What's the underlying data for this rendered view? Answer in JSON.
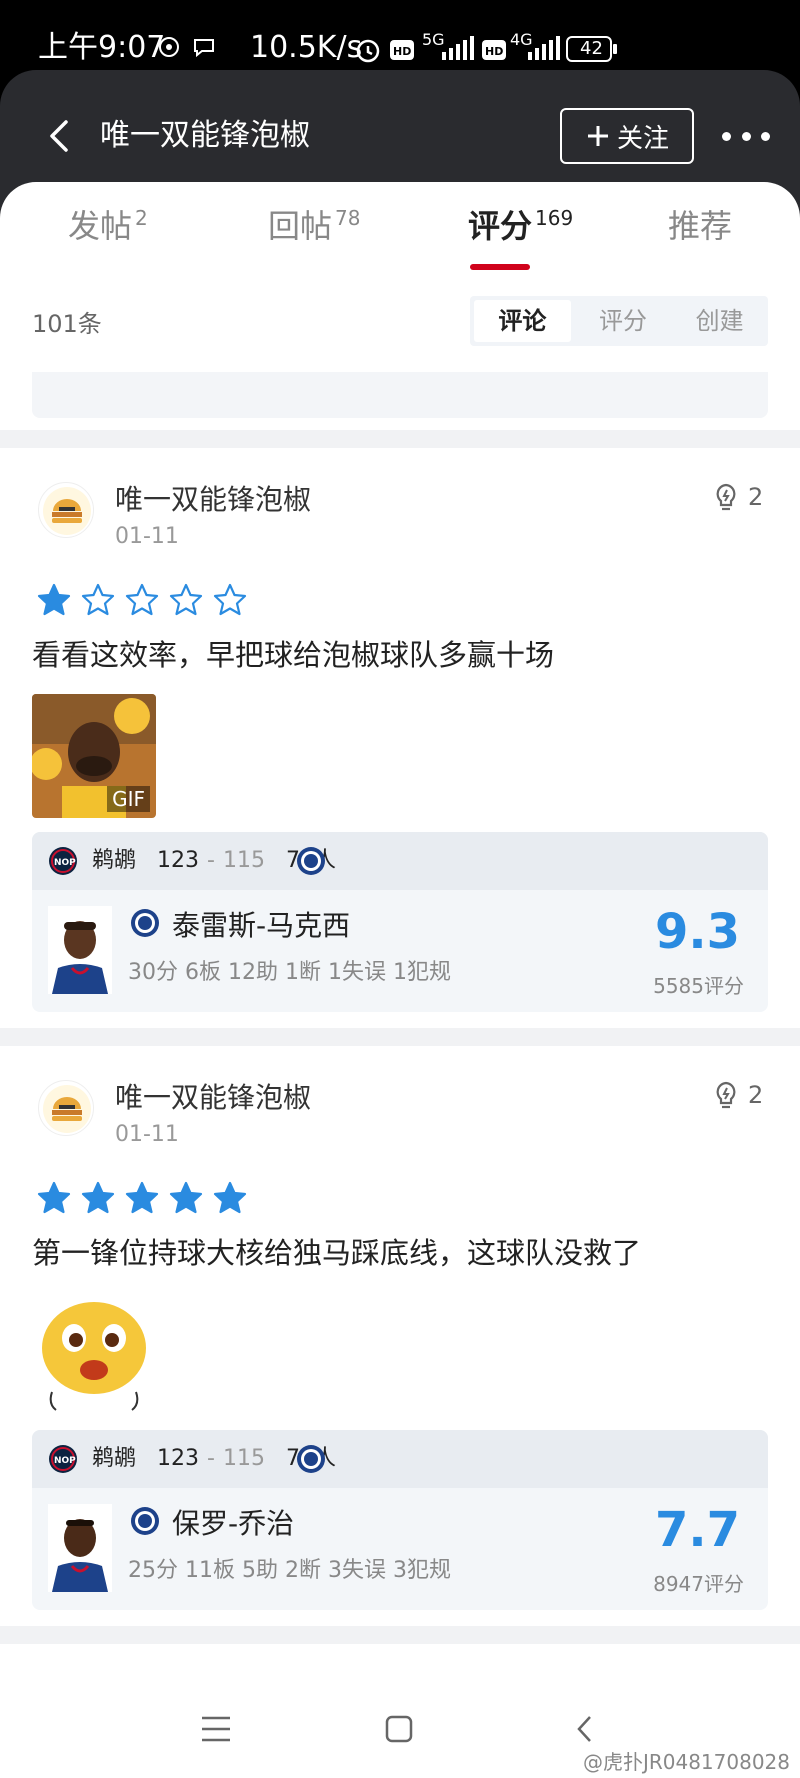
{
  "status_bar": {
    "time": "上午9:07",
    "speed": "10.5K/s",
    "network_1": "5G",
    "network_2": "4G",
    "battery": "42"
  },
  "header": {
    "title": "唯一双能锋泡椒",
    "follow_label": "关注"
  },
  "tabs": [
    {
      "label": "发帖",
      "count": "2"
    },
    {
      "label": "回帖",
      "count": "78"
    },
    {
      "label": "评分",
      "count": "169"
    },
    {
      "label": "推荐",
      "count": ""
    }
  ],
  "active_tab": "评分",
  "list": {
    "count_label": "101条",
    "segments": [
      "评论",
      "评分",
      "创建"
    ],
    "active_segment": "评论"
  },
  "posts": [
    {
      "author": "唯一双能锋泡椒",
      "date": "01-11",
      "likes": "2",
      "stars_filled": 1,
      "stars_total": 5,
      "comment": "看看这效率，早把球给泡椒球队多赢十场",
      "media_type": "GIF",
      "game": {
        "home": "鹈鹕",
        "home_score": "123",
        "away_score": "115",
        "away": "76人"
      },
      "player": {
        "name": "泰雷斯-马克西",
        "stats": "30分 6板 12助 1断 1失误 1犯规",
        "rating": "9.3",
        "rating_count": "5585评分"
      }
    },
    {
      "author": "唯一双能锋泡椒",
      "date": "01-11",
      "likes": "2",
      "stars_filled": 5,
      "stars_total": 5,
      "comment": "第一锋位持球大核给独马踩底线，这球队没救了",
      "media_type": "emoji",
      "game": {
        "home": "鹈鹕",
        "home_score": "123",
        "away_score": "115",
        "away": "76人"
      },
      "player": {
        "name": "保罗-乔治",
        "stats": "25分 11板 5助 2断 3失误 3犯规",
        "rating": "7.7",
        "rating_count": "8947评分"
      }
    }
  ],
  "watermark": "@虎扑JR0481708028",
  "colors": {
    "accent_red": "#d0021b",
    "rating_blue": "#2a8be0",
    "star_blue": "#2a8be0",
    "header_bg": "#2a2b2f"
  }
}
